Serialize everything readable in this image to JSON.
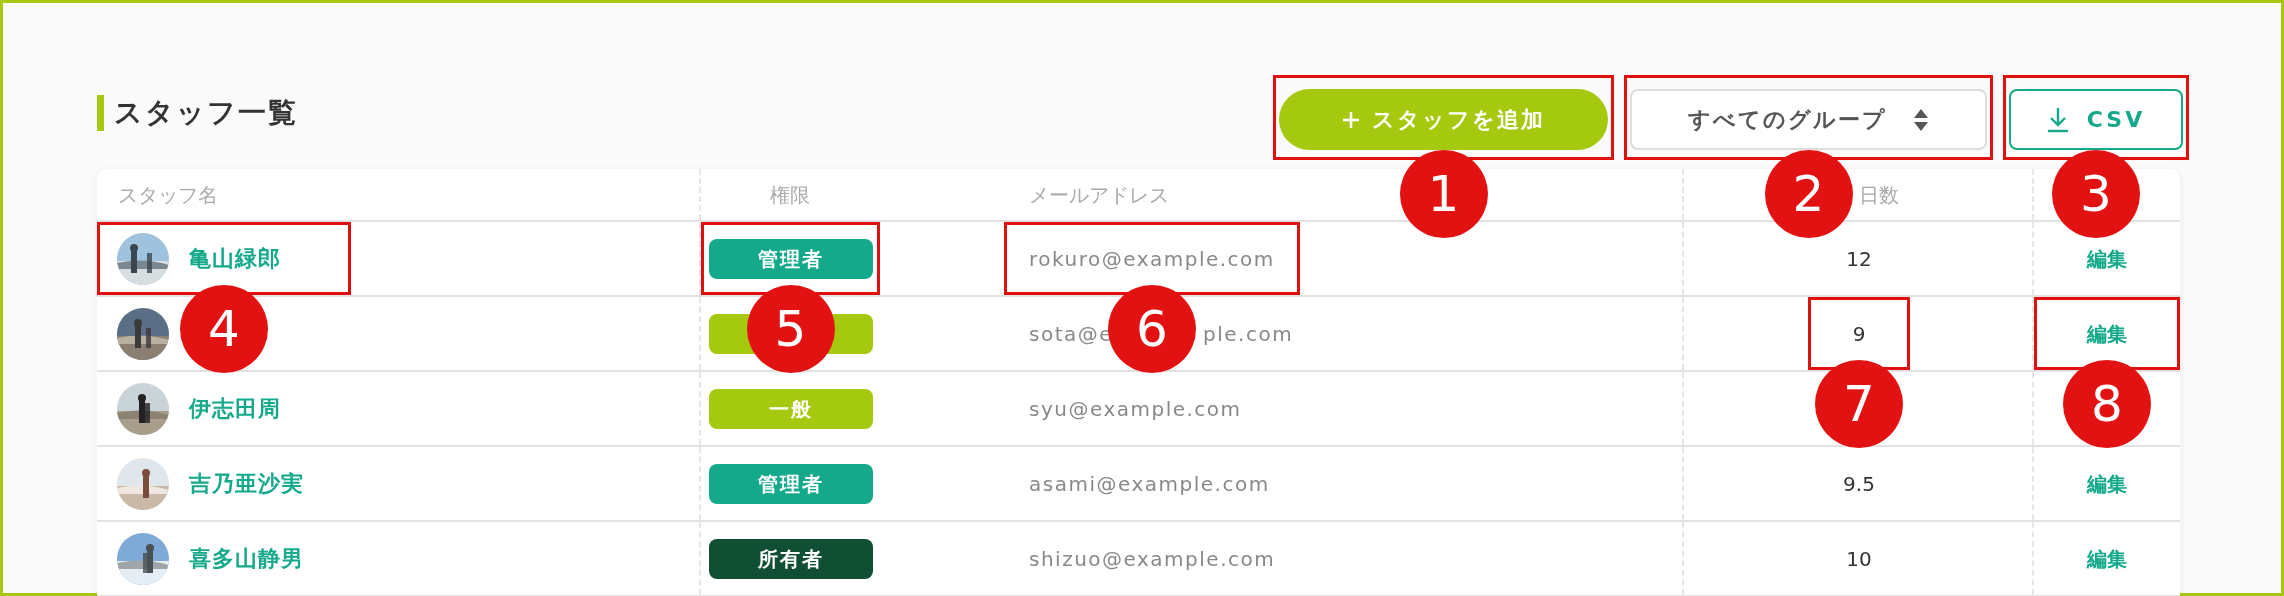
{
  "page_title": "スタッフ一覧",
  "toolbar": {
    "add_button": {
      "label": "スタッフを追加",
      "callout": "1"
    },
    "group_select": {
      "value": "すべてのグループ",
      "callout": "2"
    },
    "csv_button": {
      "label": "CSV",
      "callout": "3"
    }
  },
  "table": {
    "columns": [
      "スタッフ名",
      "権限",
      "メールアドレス",
      "日数"
    ],
    "rows": [
      {
        "name": "亀山緑郎",
        "name_callout": "4",
        "role": {
          "label": "管理者",
          "color": "#14a98b",
          "callout": "5"
        },
        "email": "rokuro@example.com",
        "email_callout": "6",
        "days": "12",
        "edit": "編集"
      },
      {
        "role": {
          "color": "#a5c90f"
        },
        "email": [
          "sota@e",
          "ple.com"
        ],
        "days": "9",
        "days_callout": "7",
        "edit": "編集",
        "edit_callout": "8"
      },
      {
        "name": "伊志田周",
        "role": {
          "label": "一般",
          "color": "#a5c90f"
        },
        "email": "syu@example.com"
      },
      {
        "name": "吉乃亜沙実",
        "role": {
          "label": "管理者",
          "color": "#14a98b"
        },
        "email": "asami@example.com",
        "days": "9.5",
        "edit": "編集"
      },
      {
        "name": "喜多山静男",
        "role": {
          "label": "所有者",
          "color": "#114f35"
        },
        "email": "shizuo@example.com",
        "days": "10",
        "edit": "編集"
      }
    ]
  }
}
